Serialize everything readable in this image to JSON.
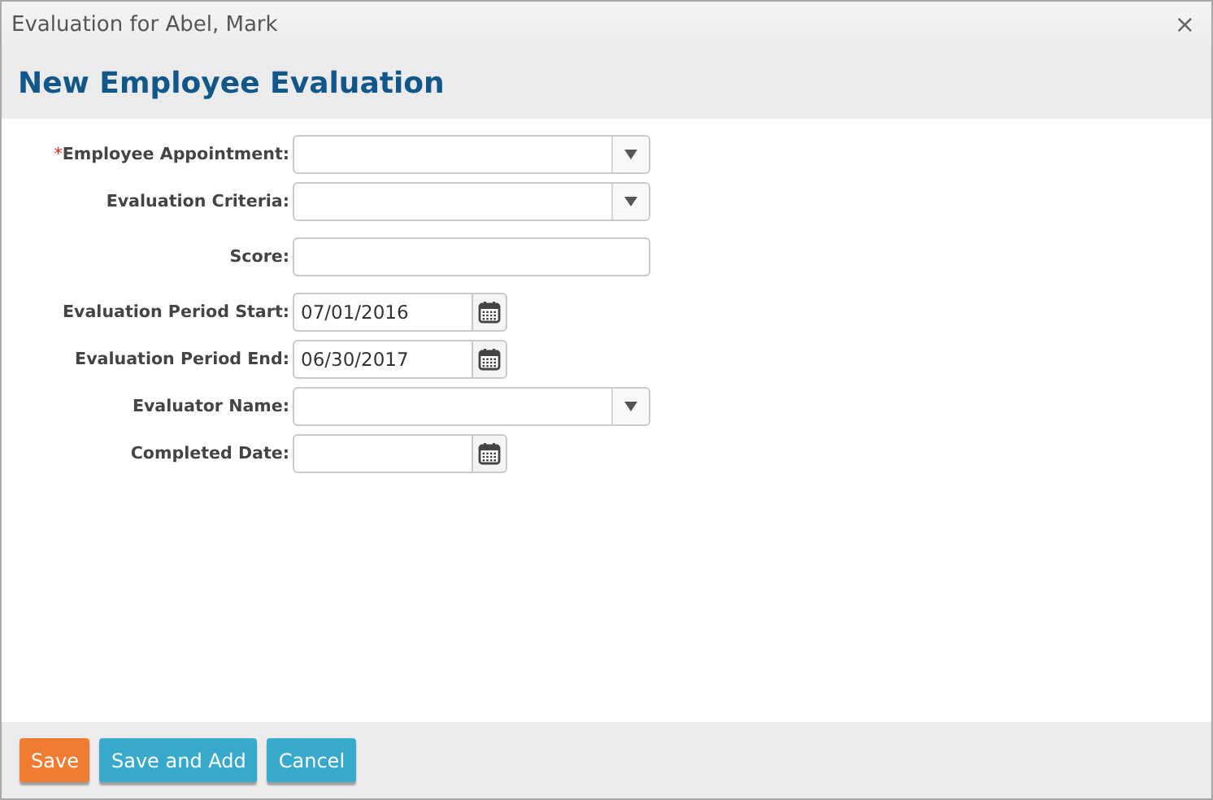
{
  "window": {
    "title": "Evaluation for Abel, Mark",
    "close": "×"
  },
  "heading": "New Employee Evaluation",
  "fields": [
    {
      "label": "Employee Appointment:",
      "kind": "select",
      "required_mark": "*"
    },
    {
      "label": "Evaluation Criteria:",
      "kind": "select"
    },
    {
      "label": "Score:",
      "kind": "text"
    },
    {
      "label": "Evaluation Period Start:",
      "kind": "date",
      "value": "07/01/2016"
    },
    {
      "label": "Evaluation Period End:",
      "kind": "date",
      "value": "06/30/2017"
    },
    {
      "label": "Evaluator Name:",
      "kind": "select"
    },
    {
      "label": "Completed Date:",
      "kind": "date"
    }
  ],
  "buttons": [
    {
      "label": "Save",
      "kind": "primary"
    },
    {
      "label": "Save and Add",
      "kind": "secondary"
    },
    {
      "label": "Cancel",
      "kind": "secondary"
    }
  ]
}
